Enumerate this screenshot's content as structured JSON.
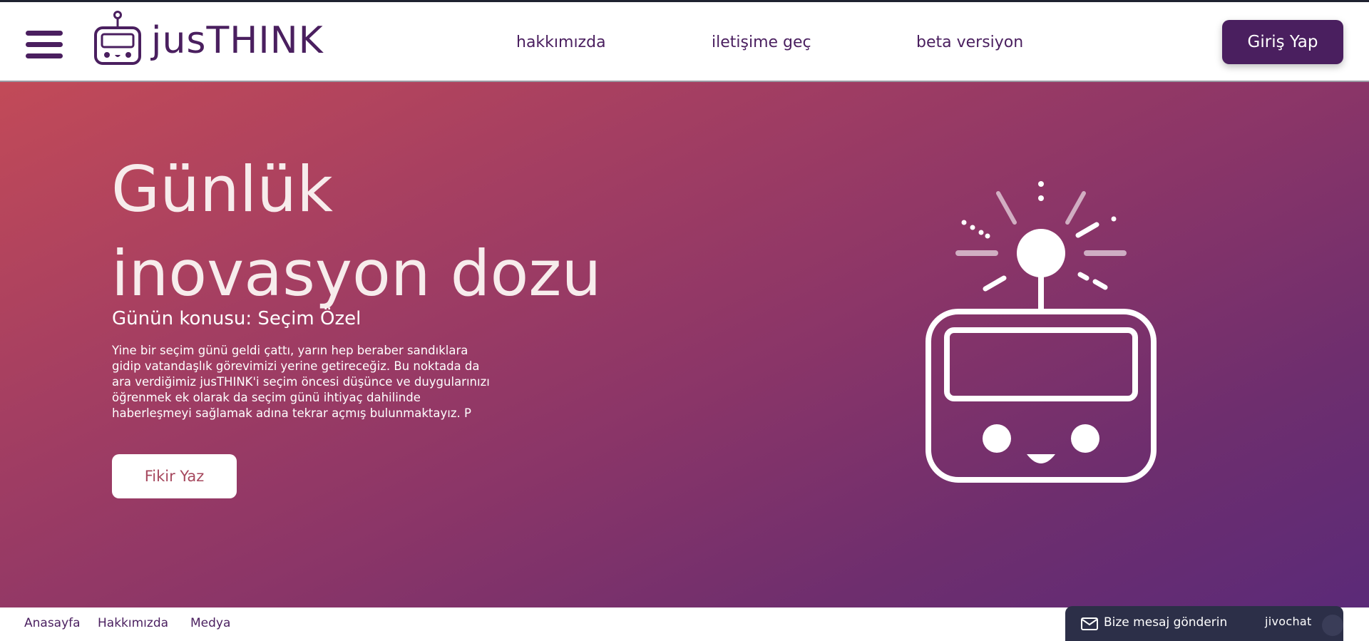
{
  "header": {
    "logo_text": "jusTHINK",
    "nav": [
      {
        "label": "hakkımızda"
      },
      {
        "label": "iletişime geç"
      },
      {
        "label": "beta versiyon"
      }
    ],
    "login_label": "Giriş Yap"
  },
  "hero": {
    "title_line1": "Günlük",
    "title_line2": "inovasyon dozu",
    "subtitle": "Günün konusu: Seçim Özel",
    "body": "Yine bir seçim günü geldi çattı, yarın hep beraber sandıklara gidip vatandaşlık görevimizi yerine getireceğiz. Bu noktada da ara verdiğimiz jusTHINK'i seçim öncesi düşünce ve duygularınızı öğrenmek ek olarak da seçim günü ihtiyaç dahilinde haberleşmeyi sağlamak adına tekrar açmış bulunmaktayız. P",
    "cta_label": "Fikir Yaz"
  },
  "footer": {
    "links": [
      {
        "label": "Anasayfa"
      },
      {
        "label": "Hakkımızda"
      },
      {
        "label": "Medya"
      }
    ]
  },
  "chat": {
    "label": "Bize mesaj gönderin",
    "brand": "jivochat"
  },
  "colors": {
    "brand": "#4a1f5f",
    "hero_start": "#c24a58",
    "hero_end": "#5b2a78",
    "chat_bg": "#2c2f48"
  },
  "icons": [
    "menu-icon",
    "robot-logo-icon",
    "robot-illustration",
    "mail-icon"
  ]
}
